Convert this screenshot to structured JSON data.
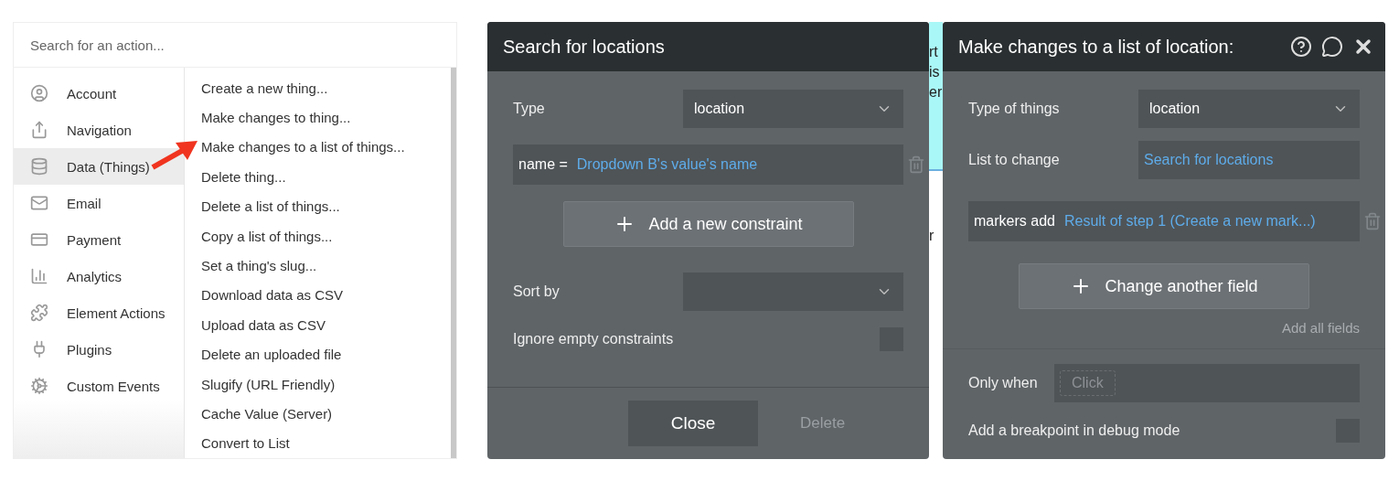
{
  "action_picker": {
    "search": {
      "placeholder": "Search for an action..."
    },
    "categories": [
      {
        "label": "Account",
        "selected": false
      },
      {
        "label": "Navigation",
        "selected": false
      },
      {
        "label": "Data (Things)",
        "selected": true
      },
      {
        "label": "Email",
        "selected": false
      },
      {
        "label": "Payment",
        "selected": false
      },
      {
        "label": "Analytics",
        "selected": false
      },
      {
        "label": "Element Actions",
        "selected": false
      },
      {
        "label": "Plugins",
        "selected": false
      },
      {
        "label": "Custom Events",
        "selected": false
      }
    ],
    "actions": [
      "Create a new thing...",
      "Make changes to thing...",
      "Make changes to a list of things...",
      "Delete thing...",
      "Delete a list of things...",
      "Copy a list of things...",
      "Set a thing's slug...",
      "Download data as CSV",
      "Upload data as CSV",
      "Delete an uploaded file",
      "Slugify (URL Friendly)",
      "Cache Value (Server)",
      "Convert to List"
    ]
  },
  "search_panel": {
    "title": "Search for locations",
    "type": {
      "label": "Type",
      "value": "location"
    },
    "constraint": {
      "field": "name =",
      "value": "Dropdown B's value's name"
    },
    "add_button": "Add a new constraint",
    "sort": {
      "label": "Sort by"
    },
    "ignore_empty": {
      "label": "Ignore empty constraints",
      "checked": false
    },
    "close_button": "Close",
    "delete_button": {
      "label": "Delete",
      "disabled": true
    }
  },
  "backdrop_fragments": [
    "rt",
    "is",
    "er",
    "r"
  ],
  "change_panel": {
    "title": "Make changes to a list of location:",
    "type": {
      "label": "Type of things",
      "value": "location"
    },
    "list": {
      "label": "List to change",
      "value": "Search for locations"
    },
    "change": {
      "field": "markers add",
      "value": "Result of step 1 (Create a new mark...)"
    },
    "add_button": "Change another field",
    "add_all": "Add all fields",
    "only_when": {
      "label": "Only when",
      "placeholder": "Click"
    },
    "breakpoint": {
      "label": "Add a breakpoint in debug mode",
      "checked": false
    }
  }
}
